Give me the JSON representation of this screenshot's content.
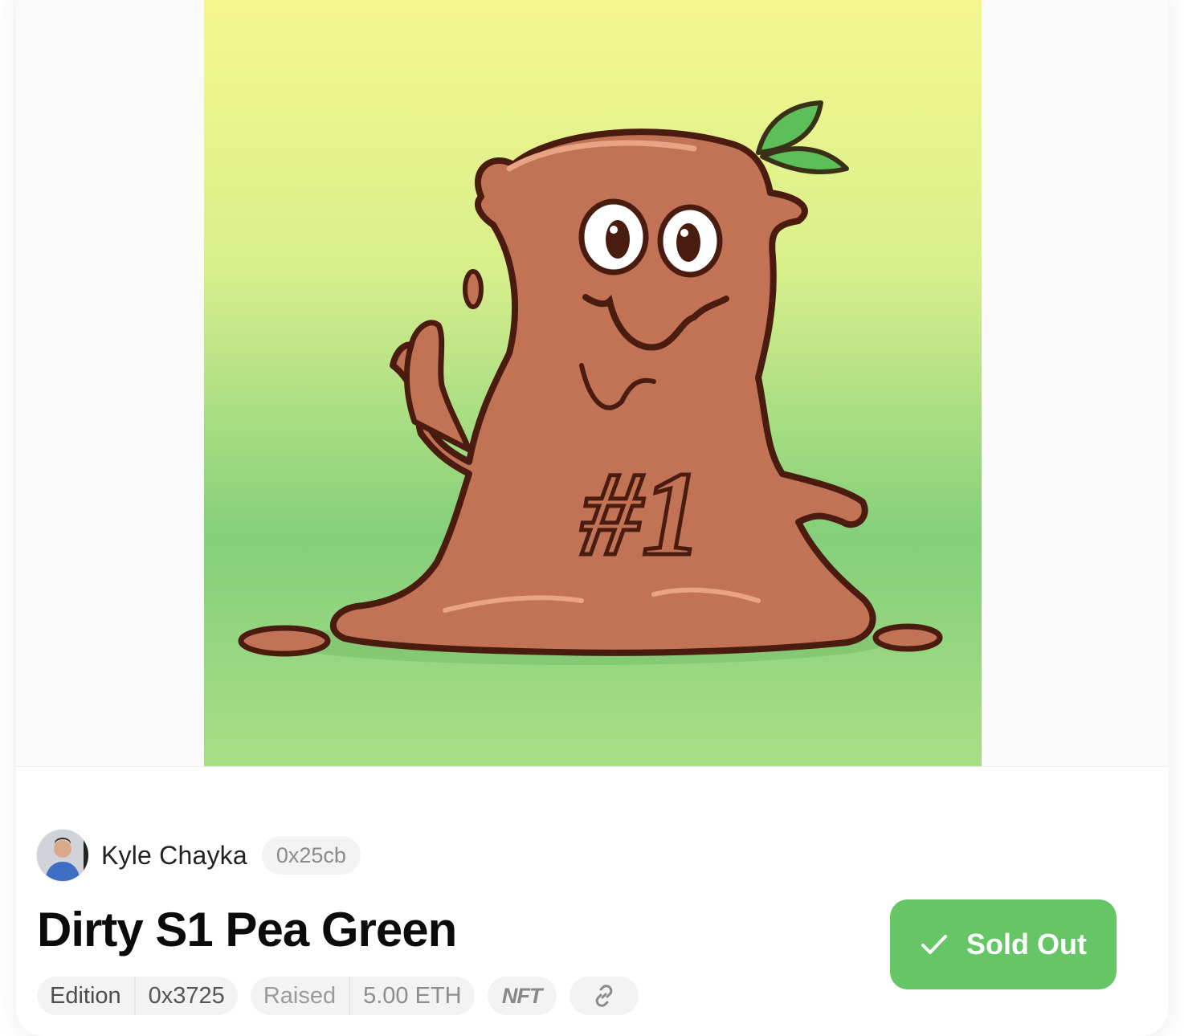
{
  "artwork": {
    "alt": "Dirty S1 Pea Green artwork",
    "gradient_top": "#f5f78e",
    "gradient_mid": "#8ad17c",
    "gradient_bottom": "#a8dd86",
    "body_color": "#c27355",
    "outline_color": "#4a1c10",
    "leaf_color": "#5cbf5a",
    "jersey_number": "#1"
  },
  "creator": {
    "name": "Kyle Chayka",
    "address": "0x25cb",
    "avatar_icon": "person-avatar"
  },
  "item": {
    "title": "Dirty S1 Pea Green"
  },
  "status": {
    "label": "Sold Out",
    "icon": "checkmark-icon",
    "color": "#66c666"
  },
  "meta": {
    "edition_label": "Edition",
    "edition_value": "0x3725",
    "raised_label": "Raised",
    "raised_value": "5.00 ETH",
    "nft_label": "NFT",
    "link_icon": "link-icon"
  }
}
